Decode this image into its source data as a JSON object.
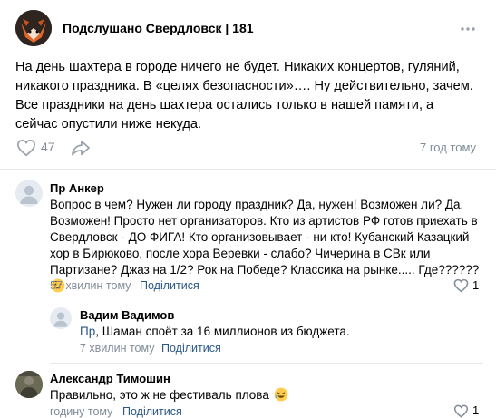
{
  "post": {
    "group_title": "Подслушано Свердловск | 181",
    "text": "На день шахтера в городе ничего не будет. Никаких концертов, гуляний, никакого праздника. В «целях безопасности»…. Ну действительно, зачем. Все праздники на день шахтера остались только в нашей памяти, а сейчас опустили ниже некуда.",
    "likes": "47",
    "time": "7 год тому",
    "more_icon": "more-dots-icon"
  },
  "comments": [
    {
      "author": "Пр Анкер",
      "text": "Вопрос в чем? Нужен ли городу праздник? Да, нужен! Возможен ли? Да. Возможен! Просто нет организаторов. Кто из артистов РФ готов приехать в Свердловск - ДО ФИГА! Кто организовывает - ни кто! Кубанский Казацкий хор в Бирюково, после хора Веревки - слабо? Чичерина в СВк или Партизане? Джаз на 1/2? Рок на Победе? Классика на рынке..... Где??????",
      "time": "57 хвилин тому",
      "share": "Поділитися",
      "likes": "1"
    },
    {
      "author": "Вадим Вадимов",
      "reply_to": "Пр",
      "text": ", Шаман споёт за 16 миллионов из бюджета.",
      "time": "7 хвилин тому",
      "share": "Поділитися"
    },
    {
      "author": "Александр Тимошин",
      "text": "Правильно, это ж не фестиваль плова",
      "time": "годину тому",
      "share": "Поділитися",
      "likes": "1"
    }
  ],
  "colors": {
    "link": "#2a5885",
    "meta": "#818c99",
    "icon": "#99a2ad",
    "divider": "#e7e8ec"
  }
}
